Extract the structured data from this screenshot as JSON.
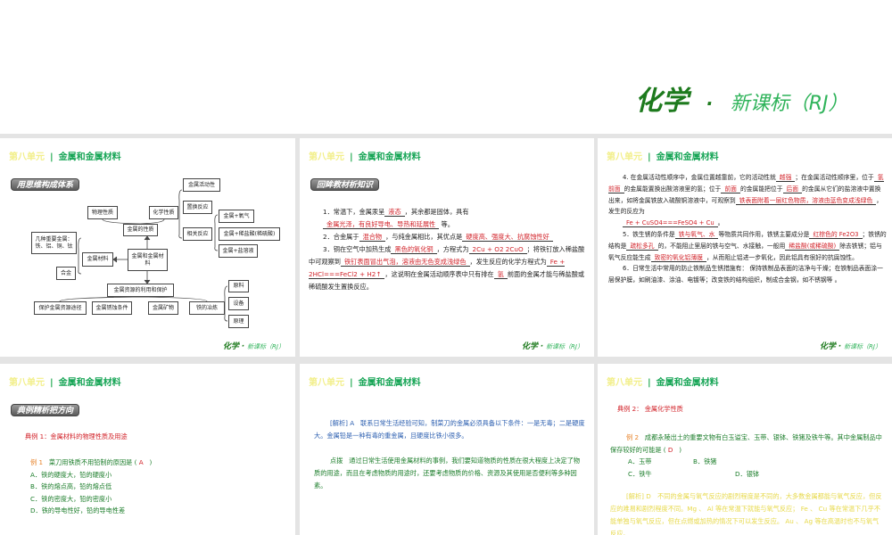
{
  "brand": {
    "main": "化学",
    "dot": "·",
    "sub": "新课标（RJ）"
  },
  "header": {
    "unit": "第八单元",
    "separator": "|",
    "title": "金属和金属材料"
  },
  "panel1": {
    "badge": "用思维构成体系",
    "nodes": {
      "activity": "金属活动性",
      "physical": "物理性质",
      "chemical": "化学性质",
      "replace": "置换反应",
      "oxygen": "金属+氧气",
      "props": "金属的性质",
      "related": "相关反应",
      "acid": "金属+稀盐酸(稀硫酸)",
      "metals": "几种重要金属：铁、铝、铜、钛",
      "salt": "金属+盐溶液",
      "root": "金属和金属材料",
      "materials": "金属材料",
      "alloy": "合金",
      "resources": "金属资源的利用和保护",
      "raw": "原料",
      "equip": "设备",
      "principle": "原理",
      "protect": "保护金属资源途径",
      "rust": "金属锈蚀条件",
      "ore": "金属矿物",
      "smelt": "铁的冶炼"
    }
  },
  "panel2": {
    "badge": "回眸教材析知识",
    "l1a": "1．常温下，金属汞呈",
    "a1": "液态",
    "l1b": "，其余都是固体，具有",
    "a2": "金属光泽，有良好导电、导热和延展性",
    "l1c": "等。",
    "l2a": "2．合金属于",
    "a3": "混合物",
    "l2b": "，与纯金属相比，其优点是",
    "a4": "硬度高、强度大、抗腐蚀性好",
    "l3a": "3．铜在空气中加热生成",
    "a5": "黑色的氧化铜",
    "l3b": "，方程式为",
    "a6": "2Cu + O2 2CuO",
    "l3c": "；将铁钉放入稀盐酸中可观察到",
    "a7": "铁钉表面冒出气泡，溶液由无色变成浅绿色",
    "l3d": "，发生反应的化学方程式为",
    "a8": "Fe + 2HCl===FeCl2 + H2↑",
    "l3e": "，这说明在金属活动顺序表中只有排在",
    "a9": "氢",
    "l3f": "前面的金属才能与稀盐酸或稀硫酸发生置换反应。"
  },
  "panel3": {
    "l4a": "4. 在金属活动性顺序中，金属位置越靠前，它的活动性就",
    "a1": "越强",
    "l4b": "；在金属活动性顺序里，位于",
    "a2": "氢前面",
    "l4c": "的金属能置换出酸溶液里的氢；位于",
    "a3": "前面",
    "l4d": "的金属能把位于",
    "a4": "后面",
    "l4e": "的金属从它们的盐溶液中置换出来，如将金属铁放入硫酸铜溶液中，可观察到",
    "a5": "铁表面附着一层红色物质，溶液由蓝色变成浅绿色",
    "l4f": "，发生的反应为",
    "a6": "Fe + CuSO4===FeSO4 + Cu",
    "l4g": "。",
    "l5a": "5．铁生锈的条件是",
    "a7": "铁与氧气、水",
    "l5b": "等物质共同作用，铁锈主要成分是",
    "a8": "红棕色的 Fe2O3",
    "l5c": "；铁锈的结构是",
    "a9": "疏松多孔",
    "l5d": "的，不能阻止里层的铁与空气、水接触，一般用",
    "a10": "稀盐酸(或稀硫酸)",
    "l5e": "除去铁锈；铝与氧气反应能生成",
    "a11": "致密的氧化铝薄膜",
    "l5f": "，从而阻止铝进一步氧化，因此铝具有很好的抗腐蚀性。",
    "l6": "6．日常生活中常用的防止铁制品生锈措施有： 保持铁制品表面的洁净与干燥；在铁制品表面涂一层保护膜，如刷油漆、涂油、电镀等；改变铁的结构组织，制成合金钢，如不锈钢等 。"
  },
  "panel4": {
    "badge": "典例精析把方向",
    "topic": "典例 1：金属材料的物理性质及用途",
    "ex": "例 1",
    "q": "菜刀用铁质不用铅制的原因是 (",
    "ans": "A",
    "close": ")",
    "options": [
      "A．铁的硬度大，铅的硬度小",
      "B．铁的熔点高，铅的熔点低",
      "C．铁的密度大，铅的密度小",
      "D．铁的导电性好，铅的导电性差"
    ]
  },
  "panel5": {
    "analysis_label": "[解析] A",
    "analysis": "联系日常生活经验可知，制菜刀的金属必须具备以下条件：一是无毒；二是硬度大。金属铅是一种有毒的重金属，且硬度比铁小很多。",
    "tip_label": "点拨",
    "tip": "通过日常生活使用金属材料的事例，我们要知道物质的性质在很大程度上决定了物质的用途，而且在考虑物质的用途时，还要考虑物质的价格、资源及其使用是否便利等多种因素。"
  },
  "panel6": {
    "topic": "典例 2： 金属化学性质",
    "ex": "例 2",
    "q": "成都永陵出土的重要文物有白玉谥宝、玉带、银钵、铁猪及铁牛等。其中金属制品中保存较好的可能是 (",
    "ans": "D",
    "close": ")",
    "options": [
      "A．玉带",
      "B．铁猪",
      "C．铁牛",
      "D．银钵"
    ],
    "analysis": "[解析] D　不同的金属与氧气反应的剧烈程度是不同的，大多数金属都能与氧气反应，但反应的难易和剧烈程度不同。Mg 、 Al 等在常温下就能与氧气反应； Fe 、 Cu 等在常温下几乎不能单独与氧气反应，但在点燃或加热的情况下可以发生反应。 Au 、 Ag 等在高温时也不与氧气反应。"
  }
}
